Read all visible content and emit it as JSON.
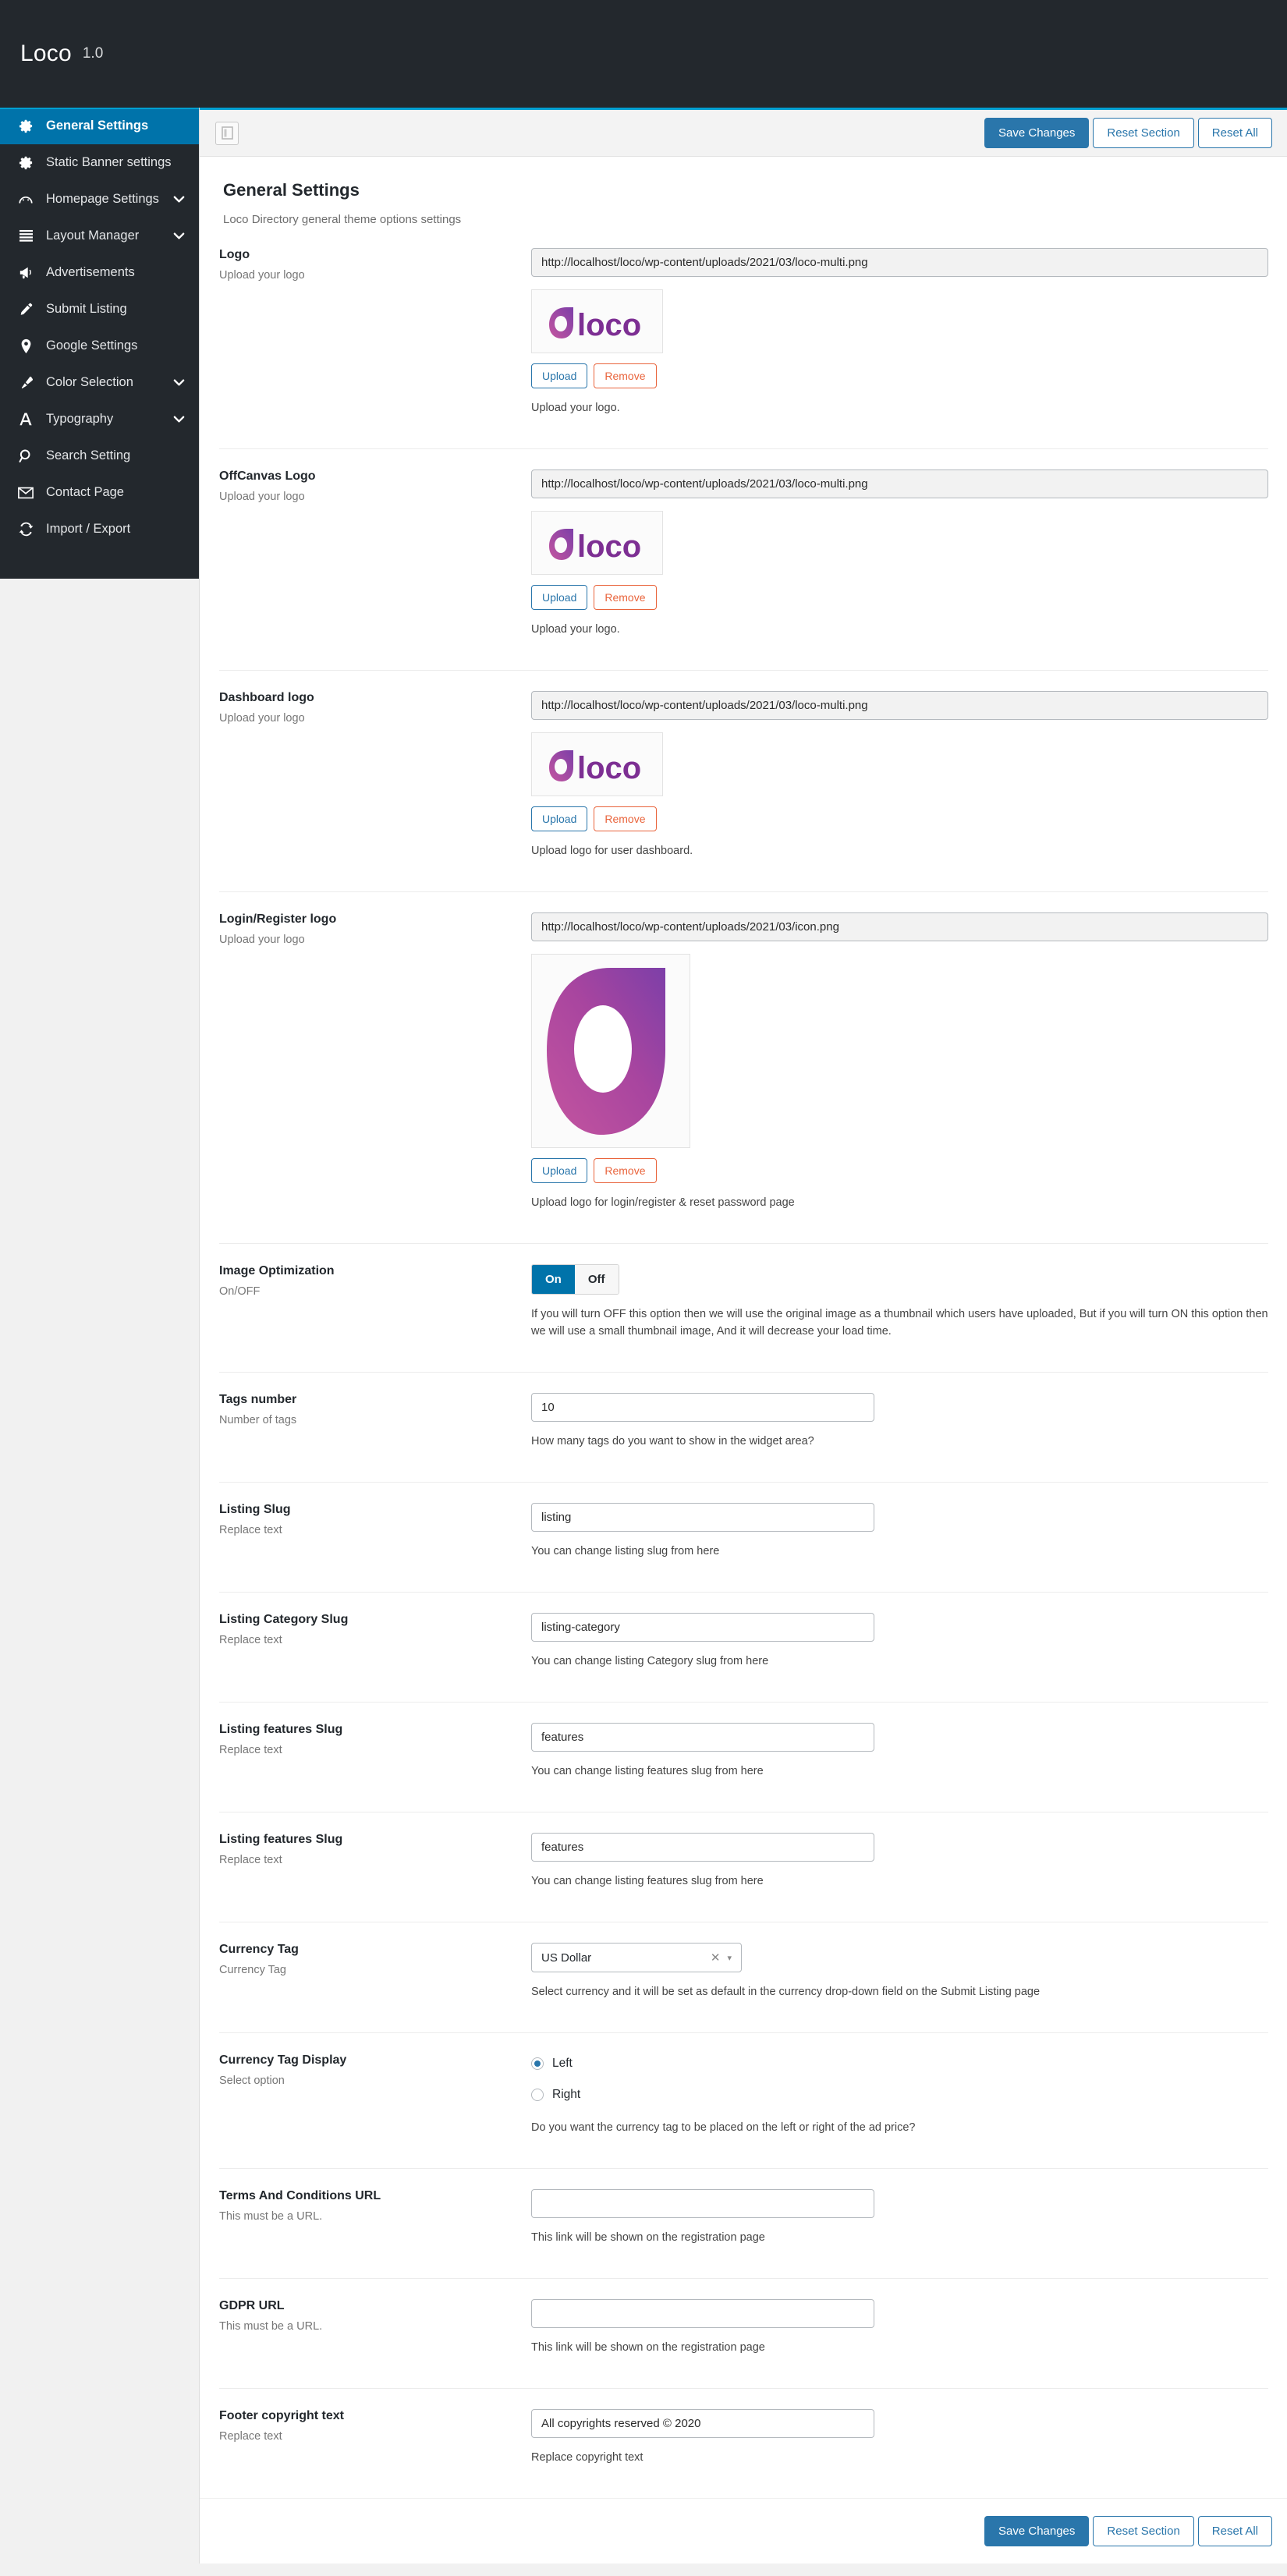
{
  "brand": {
    "name": "Loco",
    "version": "1.0"
  },
  "sidebar": {
    "items": [
      {
        "label": "General Settings",
        "icon": "gear-icon",
        "active": true,
        "caret": false
      },
      {
        "label": "Static Banner settings",
        "icon": "gear-icon",
        "active": false,
        "caret": false
      },
      {
        "label": "Homepage Settings",
        "icon": "dashboard-icon",
        "active": false,
        "caret": true
      },
      {
        "label": "Layout Manager",
        "icon": "menu-lines-icon",
        "active": false,
        "caret": true
      },
      {
        "label": "Advertisements",
        "icon": "megaphone-icon",
        "active": false,
        "caret": false
      },
      {
        "label": "Submit Listing",
        "icon": "pencil-icon",
        "active": false,
        "caret": false
      },
      {
        "label": "Google Settings",
        "icon": "map-pin-icon",
        "active": false,
        "caret": false
      },
      {
        "label": "Color Selection",
        "icon": "brush-icon",
        "active": false,
        "caret": true
      },
      {
        "label": "Typography",
        "icon": "letter-a-icon",
        "active": false,
        "caret": true
      },
      {
        "label": "Search Setting",
        "icon": "search-icon",
        "active": false,
        "caret": false
      },
      {
        "label": "Contact Page",
        "icon": "envelope-icon",
        "active": false,
        "caret": false
      },
      {
        "label": "Import / Export",
        "icon": "refresh-icon",
        "active": false,
        "caret": false
      }
    ]
  },
  "toolbar": {
    "expand_icon": "expand-panel-icon",
    "save_label": "Save Changes",
    "reset_section_label": "Reset Section",
    "reset_all_label": "Reset All"
  },
  "header": {
    "title": "General Settings",
    "subtitle": "Loco Directory general theme options settings"
  },
  "buttons": {
    "upload": "Upload",
    "remove": "Remove"
  },
  "fields": {
    "logo": {
      "title": "Logo",
      "desc": "Upload your logo",
      "value": "http://localhost/loco/wp-content/uploads/2021/03/loco-multi.png",
      "note": "Upload your logo."
    },
    "offcanvas_logo": {
      "title": "OffCanvas Logo",
      "desc": "Upload your logo",
      "value": "http://localhost/loco/wp-content/uploads/2021/03/loco-multi.png",
      "note": "Upload your logo."
    },
    "dashboard_logo": {
      "title": "Dashboard logo",
      "desc": "Upload your logo",
      "value": "http://localhost/loco/wp-content/uploads/2021/03/loco-multi.png",
      "note": "Upload logo for user dashboard."
    },
    "login_logo": {
      "title": "Login/Register logo",
      "desc": "Upload your logo",
      "value": "http://localhost/loco/wp-content/uploads/2021/03/icon.png",
      "note": "Upload logo for login/register & reset password page"
    },
    "image_optimization": {
      "title": "Image Optimization",
      "desc": "On/OFF",
      "on_label": "On",
      "off_label": "Off",
      "selected": "On",
      "note": "If you will turn OFF this option then we will use the original image as a thumbnail which users have uploaded, But if you will turn ON this option then we will use a small thumbnail image, And it will decrease your load time."
    },
    "tags_number": {
      "title": "Tags number",
      "desc": "Number of tags",
      "value": "10",
      "note": "How many tags do you want to show in the widget area?"
    },
    "listing_slug": {
      "title": "Listing Slug",
      "desc": "Replace text",
      "value": "listing",
      "note": "You can change listing slug from here"
    },
    "listing_category_slug": {
      "title": "Listing Category Slug",
      "desc": "Replace text",
      "value": "listing-category",
      "note": "You can change listing Category slug from here"
    },
    "listing_features_slug_1": {
      "title": "Listing features Slug",
      "desc": "Replace text",
      "value": "features",
      "note": "You can change listing features slug from here"
    },
    "listing_features_slug_2": {
      "title": "Listing features Slug",
      "desc": "Replace text",
      "value": "features",
      "note": "You can change listing features slug from here"
    },
    "currency_tag": {
      "title": "Currency Tag",
      "desc": "Currency Tag",
      "value": "US Dollar",
      "note": "Select currency and it will be set as default in the currency drop-down field on the Submit Listing page"
    },
    "currency_tag_display": {
      "title": "Currency Tag Display",
      "desc": "Select option",
      "options": [
        {
          "label": "Left",
          "checked": true
        },
        {
          "label": "Right",
          "checked": false
        }
      ],
      "note": "Do you want the currency tag to be placed on the left or right of the ad price?"
    },
    "terms_url": {
      "title": "Terms And Conditions URL",
      "desc": "This must be a URL.",
      "value": "",
      "note": "This link will be shown on the registration page"
    },
    "gdpr_url": {
      "title": "GDPR URL",
      "desc": "This must be a URL.",
      "value": "",
      "note": "This link will be shown on the registration page"
    },
    "footer_copyright": {
      "title": "Footer copyright text",
      "desc": "Replace text",
      "value": "All copyrights reserved © 2020",
      "note": "Replace copyright text"
    }
  },
  "colors": {
    "brand_dark": "#23282d",
    "accent_blue": "#0073aa",
    "top_rule": "#00a0d2",
    "button_blue": "#2a76ab",
    "danger": "#e9643c",
    "logo_purple": "#9b3fa0",
    "logo_magenta": "#c4559f"
  }
}
